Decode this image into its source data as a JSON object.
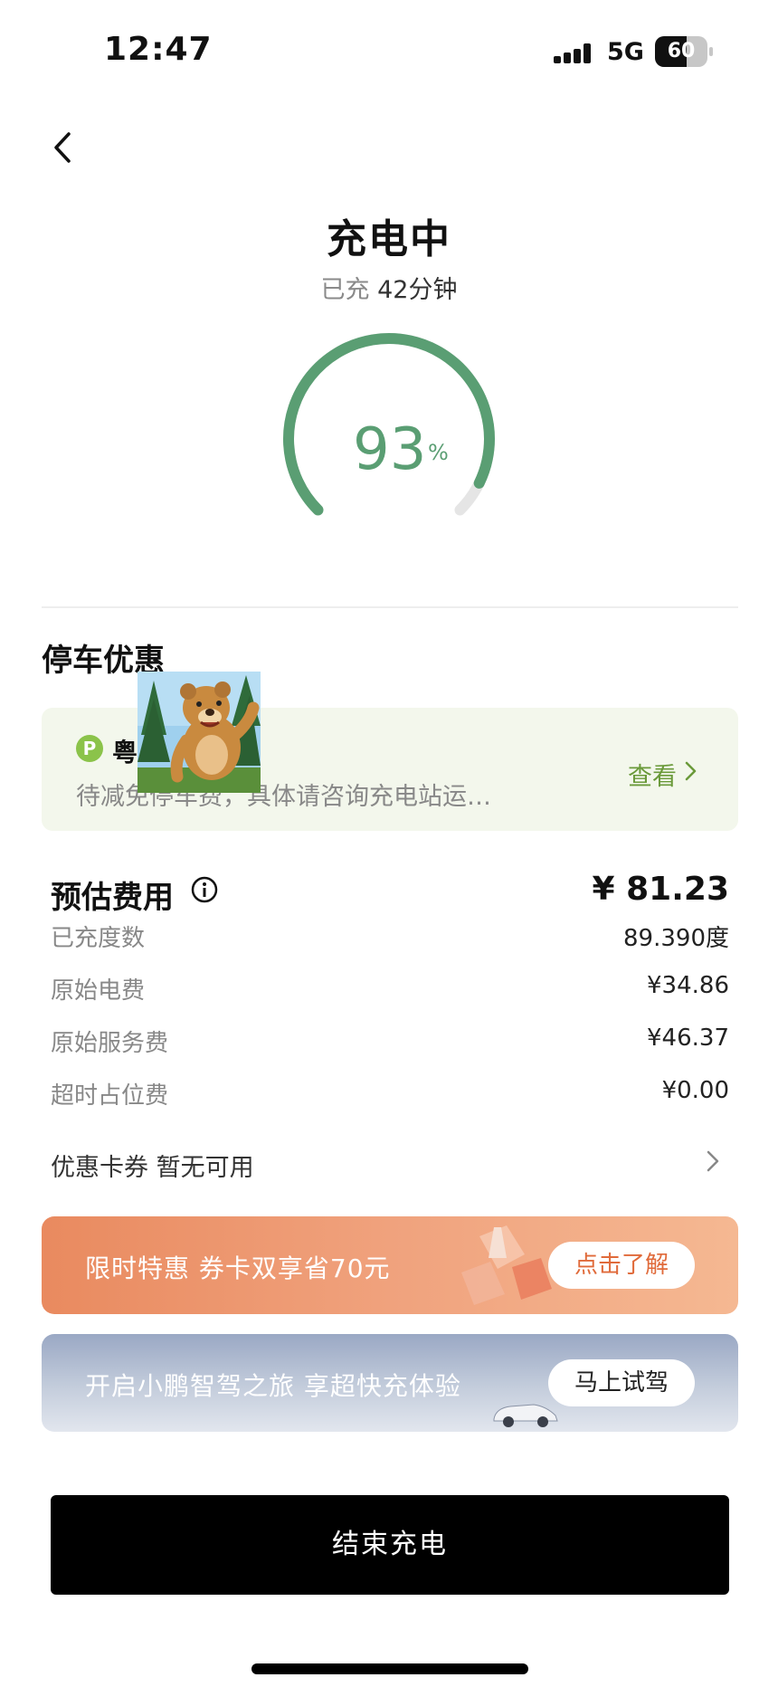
{
  "status_bar": {
    "time": "12:47",
    "network": "5G",
    "battery": "60",
    "battery_level": 0.6
  },
  "header": {
    "title": "充电中",
    "elapsed_prefix": "已充",
    "elapsed_value": "42分钟"
  },
  "gauge": {
    "value": "93",
    "unit": "%",
    "fraction": 0.93,
    "color": "#5a9e73"
  },
  "parking": {
    "section_title": "停车优惠",
    "badge": "P",
    "plate": "粤",
    "description": "待减免停车费，具体请咨询充电站运…",
    "view_label": "查看"
  },
  "fees": {
    "title": "预估费用",
    "total": "¥ 81.23",
    "rows": [
      {
        "label": "已充度数",
        "value": "89.390度"
      },
      {
        "label": "原始电费",
        "value": "¥34.86"
      },
      {
        "label": "原始服务费",
        "value": "¥46.37"
      },
      {
        "label": "超时占位费",
        "value": "¥0.00"
      }
    ],
    "coupon_label": "优惠卡券  暂无可用"
  },
  "banners": {
    "promo": {
      "text": "限时特惠  券卡双享省70元",
      "button": "点击了解"
    },
    "drive": {
      "text": "开启小鹏智驾之旅 享超快充体验",
      "button": "马上试驾"
    }
  },
  "end_button": "结束充电"
}
